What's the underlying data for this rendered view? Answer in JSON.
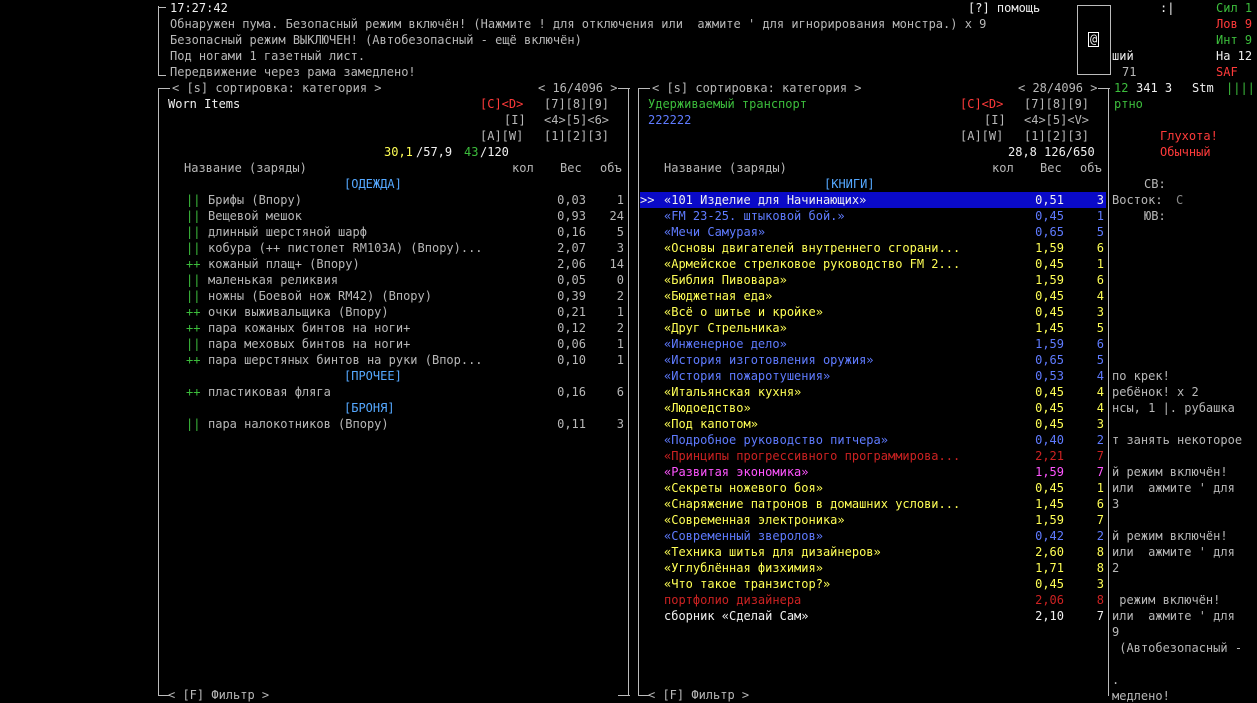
{
  "top": {
    "time": "17:27:42",
    "help": "[?] помощь",
    "messages": [
      "Обнаружен пума. Безопасный режим включён! (Нажмите ! для отключения или  ажмите ' для игнорирования монстра.) х 9",
      "Безопасный режим ВЫКЛЮЧЕН! (Автобезопасный - ещё включён)",
      "Под ногами 1 газетный лист.",
      "Передвижение через рама замедлено!"
    ],
    "minimap_glyph": "@",
    "right_top": ":|"
  },
  "right_side": {
    "stats": [
      {
        "label": "Сил 1",
        "color": "#3cbd3c"
      },
      {
        "label": "Лов 9",
        "color": "#ff3a3a"
      },
      {
        "label": "Инт 9",
        "color": "#3cbd3c"
      },
      {
        "label": "На 12",
        "color": "#f0f0f0"
      },
      {
        "label": "SAF",
        "color": "#ff3a3a"
      }
    ],
    "partial_a": "ший",
    "partial_b": "71",
    "status_line": [
      "12",
      "341 3",
      "Stm",
      "||||"
    ],
    "status_word": "ртно",
    "deaf": "Глухота!",
    "normal": "Обычный",
    "compass": [
      {
        "dir": "СВ:",
        "val": ""
      },
      {
        "dir": "Восток:",
        "val": "C"
      },
      {
        "dir": "ЮВ:",
        "val": ""
      }
    ],
    "log_lines": [
      "по крек!",
      "ребёнок! х 2",
      "нсы, 1 |. рубашка",
      "",
      "т занять некоторое",
      "",
      "й режим включён!",
      "или  ажмите ' для",
      "3",
      "",
      "й режим включён!",
      "или  ажмите ' для",
      "2",
      "",
      " режим включён!",
      "или  ажмите ' для",
      "9",
      " (Автобезопасный -",
      "",
      ".",
      "медлено!"
    ]
  },
  "left_panel": {
    "header": "< [s] сортировка: категория >",
    "count": "< 16/4096 >",
    "title": "Worn Items",
    "nav": [
      "[C]<D>",
      "[7][8][9]",
      "[I]",
      "<4>[5]<6>",
      "[A][W]",
      "[1][2][3]"
    ],
    "weight_a": "30,1",
    "weight_b": "/57,9",
    "volume_a": "43",
    "volume_b": "/120",
    "col_name": "Название (заряды)",
    "col_qty": "кол",
    "col_weight": "Вес",
    "col_vol": "объ",
    "footer": "< [F] Фильтр >",
    "groups": [
      {
        "category": "[ОДЕЖДА]",
        "items": [
          {
            "mark": "||",
            "name": "Брифы (Впору)",
            "weight": "0,03",
            "vol": "1"
          },
          {
            "mark": "||",
            "name": "Вещевой мешок",
            "weight": "0,93",
            "vol": "24"
          },
          {
            "mark": "||",
            "name": "длинный шерстяной шарф",
            "weight": "0,16",
            "vol": "5"
          },
          {
            "mark": "||",
            "name": "кобура (++ пистолет RM103A) (Впору)...",
            "weight": "2,07",
            "vol": "3"
          },
          {
            "mark": "++",
            "name": "кожаный плащ+ (Впору)",
            "weight": "2,06",
            "vol": "14"
          },
          {
            "mark": "||",
            "name": "маленькая реликвия",
            "weight": "0,05",
            "vol": "0"
          },
          {
            "mark": "||",
            "name": "ножны (Боевой нож RM42) (Впору)",
            "weight": "0,39",
            "vol": "2"
          },
          {
            "mark": "++",
            "name": "очки выживальщика (Впору)",
            "weight": "0,21",
            "vol": "1"
          },
          {
            "mark": "++",
            "name": "пара кожаных бинтов на ноги+",
            "weight": "0,12",
            "vol": "2"
          },
          {
            "mark": "||",
            "name": "пара меховых бинтов на ноги+",
            "weight": "0,06",
            "vol": "1"
          },
          {
            "mark": "++",
            "name": "пара шерстяных бинтов на руки (Впор...",
            "weight": "0,10",
            "vol": "1"
          }
        ]
      },
      {
        "category": "[ПРОЧЕЕ]",
        "items": [
          {
            "mark": "++",
            "name": "пластиковая фляга",
            "weight": "0,16",
            "vol": "6"
          }
        ]
      },
      {
        "category": "[БРОНЯ]",
        "items": [
          {
            "mark": "||",
            "name": "пара налокотников (Впору)",
            "weight": "0,11",
            "vol": "3"
          }
        ]
      }
    ]
  },
  "right_panel": {
    "header": "< [s] сортировка: категория >",
    "count": "< 28/4096 >",
    "title": "Удерживаемый транспорт",
    "subtitle": "222222",
    "nav": [
      "[C]<D>",
      "[7][8][9]",
      "[I]",
      "<4>[5]<V>",
      "[A][W]",
      "[1][2][3]"
    ],
    "weight_volume": "28,8 126/650",
    "col_name": "Название (заряды)",
    "col_qty": "кол",
    "col_weight": "Вес",
    "col_vol": "объ",
    "category": "[КНИГИ]",
    "footer": "< [F] Фильтр >",
    "cursor": ">>",
    "items": [
      {
        "name": "«101 Изделие для Начинающих»",
        "weight": "0,51",
        "vol": "3",
        "color": "#f0f0f0",
        "selected": true
      },
      {
        "name": "«FM 23-25. штыковой бой.»",
        "weight": "0,45",
        "vol": "1",
        "color": "#5f7bff"
      },
      {
        "name": "«Мечи Самурая»",
        "weight": "0,65",
        "vol": "5",
        "color": "#5f7bff"
      },
      {
        "name": "«Основы двигателей внутреннего сгорани...",
        "weight": "1,59",
        "vol": "6",
        "color": "#ffff55"
      },
      {
        "name": "«Армейское стрелковое руководство FM 2...",
        "weight": "0,45",
        "vol": "1",
        "color": "#ffff55"
      },
      {
        "name": "«Библия Пивовара»",
        "weight": "1,59",
        "vol": "6",
        "color": "#ffff55"
      },
      {
        "name": "«Бюджетная еда»",
        "weight": "0,45",
        "vol": "4",
        "color": "#ffff55"
      },
      {
        "name": "«Всё о шитье и кройке»",
        "weight": "0,45",
        "vol": "3",
        "color": "#ffff55"
      },
      {
        "name": "«Друг Стрельника»",
        "weight": "1,45",
        "vol": "5",
        "color": "#ffff55"
      },
      {
        "name": "«Инженерное дело»",
        "weight": "1,59",
        "vol": "6",
        "color": "#5f7bff"
      },
      {
        "name": "«История изготовления оружия»",
        "weight": "0,65",
        "vol": "5",
        "color": "#5f7bff"
      },
      {
        "name": "«История пожаротушения»",
        "weight": "0,53",
        "vol": "4",
        "color": "#5f7bff"
      },
      {
        "name": "«Итальянская кухня»",
        "weight": "0,45",
        "vol": "4",
        "color": "#ffff55"
      },
      {
        "name": "«Людоедство»",
        "weight": "0,45",
        "vol": "4",
        "color": "#ffff55"
      },
      {
        "name": "«Под капотом»",
        "weight": "0,45",
        "vol": "3",
        "color": "#ffff55"
      },
      {
        "name": "«Подробное руководство питчера»",
        "weight": "0,40",
        "vol": "2",
        "color": "#5f7bff"
      },
      {
        "name": "«Принципы прогрессивного программирова...",
        "weight": "2,21",
        "vol": "7",
        "color": "#cc2222"
      },
      {
        "name": "«Развитая экономика»",
        "weight": "1,59",
        "vol": "7",
        "color": "#ff55ff"
      },
      {
        "name": "«Секреты ножевого боя»",
        "weight": "0,45",
        "vol": "1",
        "color": "#ffff55"
      },
      {
        "name": "«Снаряжение патронов в домашних услови...",
        "weight": "1,45",
        "vol": "6",
        "color": "#ffff55"
      },
      {
        "name": "«Современная электроника»",
        "weight": "1,59",
        "vol": "7",
        "color": "#ffff55"
      },
      {
        "name": "«Современный зверолов»",
        "weight": "0,42",
        "vol": "2",
        "color": "#5f7bff"
      },
      {
        "name": "«Техника шитья для дизайнеров»",
        "weight": "2,60",
        "vol": "8",
        "color": "#ffff55"
      },
      {
        "name": "«Углублённая физхимия»",
        "weight": "1,71",
        "vol": "8",
        "color": "#ffff55"
      },
      {
        "name": "«Что такое транзистор?»",
        "weight": "0,45",
        "vol": "3",
        "color": "#ffff55"
      },
      {
        "name": "портфолио дизайнера",
        "weight": "2,06",
        "vol": "8",
        "color": "#cc2222"
      },
      {
        "name": "сборник «Сделай Сам»",
        "weight": "2,10",
        "vol": "7",
        "color": "#f0f0f0"
      }
    ]
  }
}
